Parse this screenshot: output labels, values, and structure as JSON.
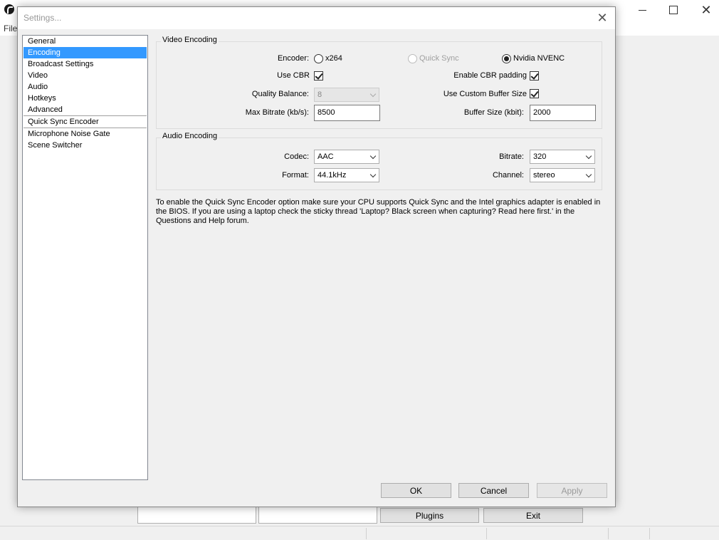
{
  "background": {
    "menu_file": "File",
    "buttons": {
      "plugins": "Plugins",
      "exit": "Exit"
    }
  },
  "dialog": {
    "title": "Settings...",
    "sidebar": {
      "items": [
        "General",
        "Encoding",
        "Broadcast Settings",
        "Video",
        "Audio",
        "Hotkeys",
        "Advanced"
      ],
      "plugin_items": [
        "Quick Sync Encoder",
        "Microphone Noise Gate",
        "Scene Switcher"
      ],
      "active": "Encoding"
    },
    "video_encoding": {
      "group_label": "Video Encoding",
      "encoder_label": "Encoder:",
      "encoder_options": [
        "x264",
        "Quick Sync",
        "Nvidia NVENC"
      ],
      "encoder_selected": "Nvidia NVENC",
      "use_cbr_label": "Use CBR",
      "use_cbr_checked": true,
      "enable_cbr_padding_label": "Enable CBR padding",
      "enable_cbr_padding_checked": true,
      "quality_balance_label": "Quality Balance:",
      "quality_balance_value": "8",
      "use_custom_buffer_label": "Use Custom Buffer Size",
      "use_custom_buffer_checked": true,
      "max_bitrate_label": "Max Bitrate (kb/s):",
      "max_bitrate_value": "8500",
      "buffer_size_label": "Buffer Size (kbit):",
      "buffer_size_value": "2000"
    },
    "audio_encoding": {
      "group_label": "Audio Encoding",
      "codec_label": "Codec:",
      "codec_value": "AAC",
      "bitrate_label": "Bitrate:",
      "bitrate_value": "320",
      "format_label": "Format:",
      "format_value": "44.1kHz",
      "channel_label": "Channel:",
      "channel_value": "stereo"
    },
    "info_text": "To enable the Quick Sync Encoder option make sure your CPU supports Quick Sync and the Intel graphics adapter is enabled in the BIOS. If you are using a laptop check the sticky thread 'Laptop? Black screen when capturing? Read here first.' in the Questions and Help forum.",
    "buttons": {
      "ok": "OK",
      "cancel": "Cancel",
      "apply": "Apply"
    }
  }
}
